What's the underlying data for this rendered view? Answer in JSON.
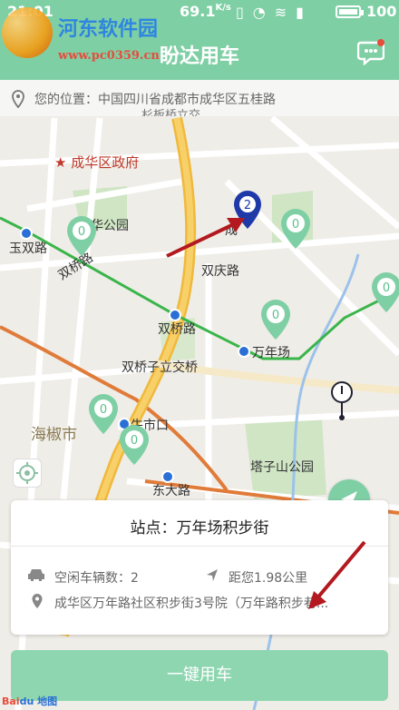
{
  "status": {
    "time": "21:01",
    "speed": "69.1",
    "speed_unit": "K/s",
    "battery": "100"
  },
  "watermark": {
    "title": "河东软件园",
    "url": "www.pc0359.cn"
  },
  "header": {
    "title": "盼达用车",
    "chat_icon": "chat-bubble-icon"
  },
  "location": {
    "label": "您的位置：中国四川省成都市成华区五桂路",
    "sub": "杉板桥立交"
  },
  "map": {
    "labels": [
      "成华区政府",
      "华公园",
      "玉双路",
      "双桥路",
      "双庆路",
      "双桥路",
      "万年场",
      "双桥子立交桥",
      "海椒市",
      "牛市口",
      "东大路",
      "塔子山公园",
      "成"
    ],
    "pin_count": "0",
    "selected_pin": "2",
    "route_color": "#3ab54a",
    "road_color": "#f5c242"
  },
  "card": {
    "station": "站点：万年场积步街",
    "idle_label": "空闲车辆数：2",
    "distance": "距您1.98公里",
    "address": "成华区万年路社区积步街3号院（万年路积步巷..."
  },
  "actions": {
    "use_car": "一键用车"
  },
  "attribution": {
    "logo": "Bai",
    "logo_accent": "du",
    "suffix": "地图"
  }
}
